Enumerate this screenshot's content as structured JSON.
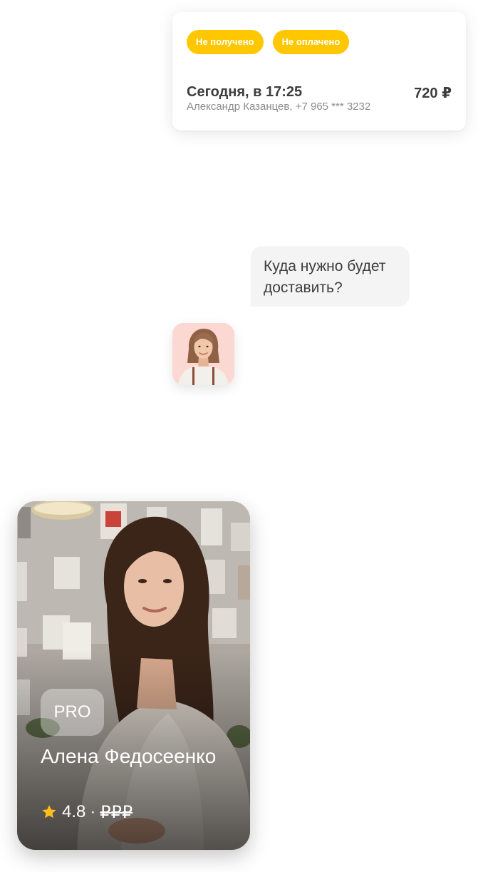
{
  "order": {
    "badges": [
      "Не получено",
      "Не оплачено"
    ],
    "datetime": "Сегодня, в 17:25",
    "price": "720 ₽",
    "customer": "Александр Казанцев, +7 965 *** 3232"
  },
  "chat": {
    "message": "Куда нужно будет доставить?"
  },
  "master": {
    "badge": "PRO",
    "name": "Алена Федосеенко",
    "rating": "4.8",
    "separator": "·",
    "price_level": "₽₽₽"
  },
  "icons": {
    "rating": "star-icon"
  },
  "colors": {
    "badge": "#ffc700",
    "star": "#ffbe1a",
    "bubble": "#f4f4f4",
    "avatar_bg": "#fbd8d2"
  }
}
